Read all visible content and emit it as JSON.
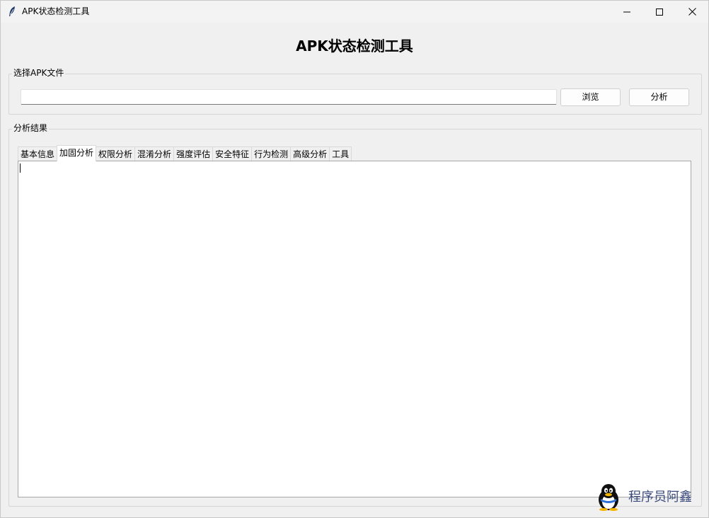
{
  "window": {
    "title": "APK状态检测工具"
  },
  "app": {
    "title": "APK状态检测工具"
  },
  "file_section": {
    "label": "选择APK文件",
    "path_value": "",
    "browse_label": "浏览",
    "analyze_label": "分析"
  },
  "results_section": {
    "label": "分析结果",
    "tabs": [
      {
        "label": "基本信息",
        "active": false
      },
      {
        "label": "加固分析",
        "active": true
      },
      {
        "label": "权限分析",
        "active": false
      },
      {
        "label": "混淆分析",
        "active": false
      },
      {
        "label": "强度评估",
        "active": false
      },
      {
        "label": "安全特征",
        "active": false
      },
      {
        "label": "行为检测",
        "active": false
      },
      {
        "label": "高级分析",
        "active": false
      },
      {
        "label": "工具",
        "active": false
      }
    ],
    "content_text": ""
  },
  "watermark": {
    "text": "程序员阿鑫",
    "icon": "penguin-icon"
  },
  "icons": {
    "app": "feather-icon",
    "minimize": "minimize-icon",
    "maximize": "maximize-icon",
    "close": "close-icon"
  }
}
